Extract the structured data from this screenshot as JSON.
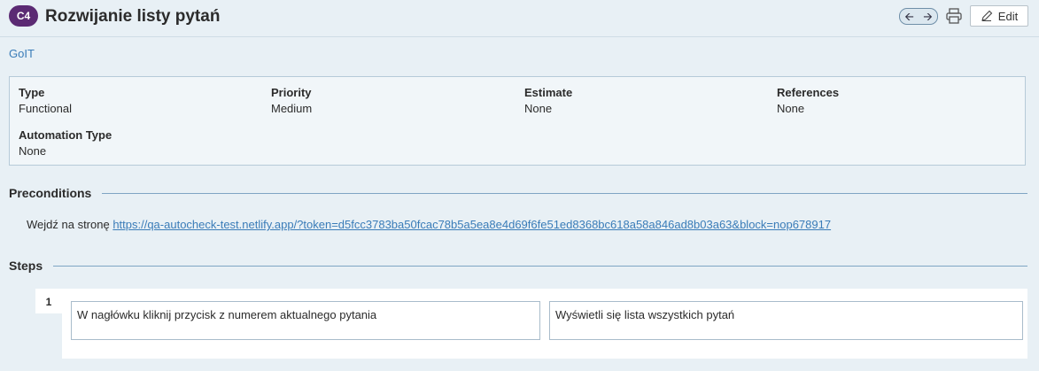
{
  "header": {
    "case_id": "C4",
    "title": "Rozwijanie listy pytań",
    "nav_prev_icon": "arrow-left-icon",
    "nav_next_icon": "arrow-right-icon",
    "print_icon": "printer-icon",
    "edit_label": "Edit"
  },
  "project": {
    "name": "GoIT"
  },
  "fields": {
    "type": {
      "label": "Type",
      "value": "Functional"
    },
    "priority": {
      "label": "Priority",
      "value": "Medium"
    },
    "estimate": {
      "label": "Estimate",
      "value": "None"
    },
    "references": {
      "label": "References",
      "value": "None"
    },
    "automation_type": {
      "label": "Automation Type",
      "value": "None"
    }
  },
  "preconditions": {
    "heading": "Preconditions",
    "text": "Wejdź na stronę ",
    "link": "https://qa-autocheck-test.netlify.app/?token=d5fcc3783ba50fcac78b5a5ea8e4d69f6fe51ed8368bc618a58a846ad8b03a63&block=nop678917"
  },
  "steps": {
    "heading": "Steps",
    "items": [
      {
        "number": "1",
        "action": "W nagłówku kliknij przycisk z numerem aktualnego pytania",
        "expected": "Wyświetli się lista wszystkich pytań"
      }
    ]
  },
  "colors": {
    "background": "#e8f0f5",
    "badge": "#5b2a73",
    "link": "#3a7cb8",
    "rule": "#7fa5c4"
  }
}
